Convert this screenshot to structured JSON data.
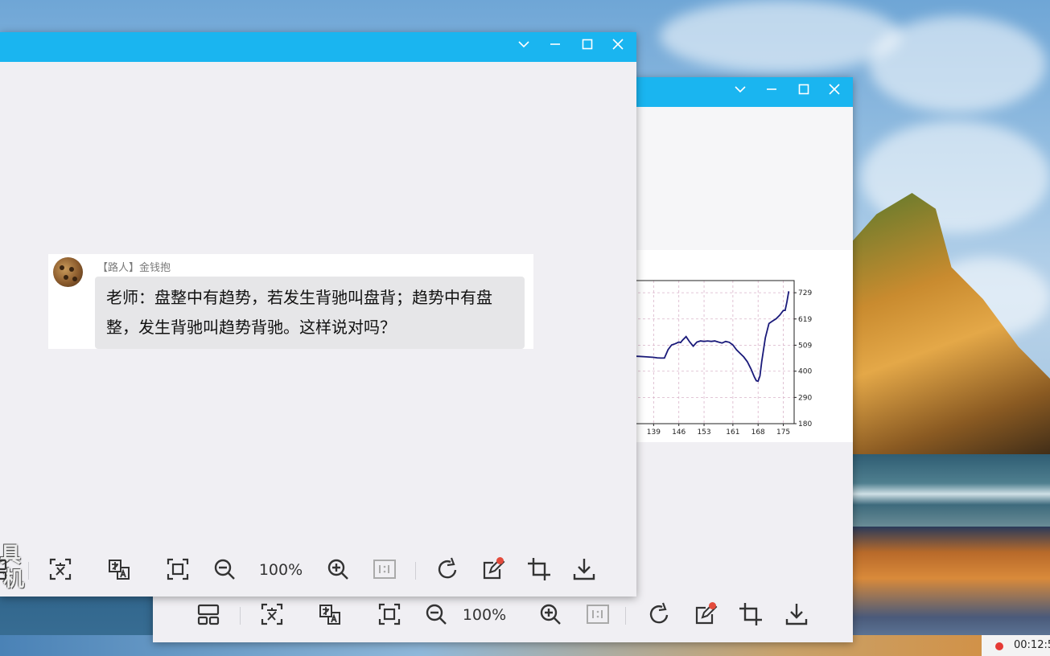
{
  "back_window": {
    "toolbar": {
      "zoom": "100%"
    },
    "chart": {
      "x_ticks": [
        "139",
        "146",
        "153",
        "161",
        "168",
        "175"
      ],
      "y_ticks": [
        "729",
        "619",
        "509",
        "400",
        "290",
        "180"
      ],
      "line_color": "#1a1a7a"
    }
  },
  "front_window": {
    "message": {
      "sender": "【路人】金钱抱",
      "text": "老师：盘整中有趋势，若发生背驰叫盘背；趋势中有盘整，发生背驰叫趋势背驰。这样说对吗？"
    },
    "toolbar": {
      "zoom": "100%"
    },
    "watermark": [
      "具",
      "机"
    ]
  },
  "chart_data": {
    "type": "line",
    "x": [
      133,
      135,
      137,
      139,
      140,
      141,
      142,
      143,
      144,
      145,
      146,
      146.5,
      147,
      148,
      149,
      150,
      151,
      152,
      153,
      154,
      155,
      156,
      157,
      158,
      159,
      160,
      161,
      162,
      163,
      164,
      165,
      166,
      167,
      167.5,
      168,
      168.5,
      169,
      170,
      171,
      172,
      173,
      174,
      175,
      175.5,
      176,
      176.5
    ],
    "y": [
      463,
      462,
      460,
      458,
      456,
      455,
      455,
      490,
      510,
      515,
      522,
      520,
      530,
      545,
      523,
      505,
      522,
      527,
      525,
      527,
      525,
      527,
      522,
      518,
      525,
      521,
      510,
      490,
      475,
      460,
      440,
      410,
      375,
      360,
      358,
      380,
      440,
      540,
      600,
      610,
      620,
      635,
      655,
      655,
      690,
      735
    ],
    "series": [
      {
        "values": []
      }
    ],
    "x_tick_labels": [
      "139",
      "146",
      "153",
      "161",
      "168",
      "175"
    ],
    "y_tick_labels": [
      "729",
      "619",
      "509",
      "400",
      "290",
      "180"
    ],
    "xlim": [
      132,
      178
    ],
    "ylim": [
      180,
      780
    ],
    "grid": true,
    "colors": {
      "line": "#1a1a7a",
      "grid": "#d9b3c9"
    }
  },
  "recording": {
    "time": "00:12:5"
  },
  "colors": {
    "titlebar": "#1ab5f0",
    "window_bg": "#f0eff3",
    "bubble": "#e6e6e8",
    "record_dot": "#e53935"
  }
}
